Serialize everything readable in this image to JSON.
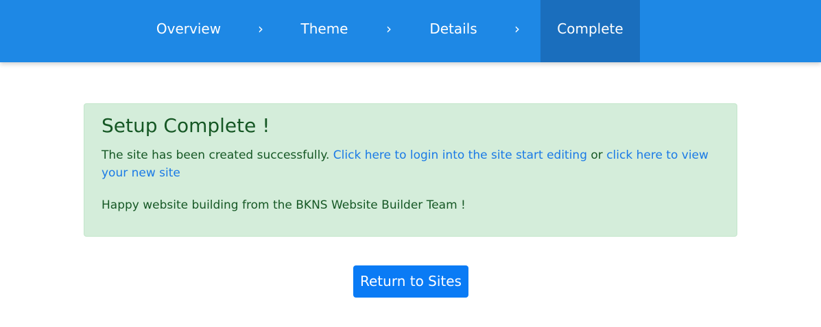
{
  "wizard": {
    "steps": [
      {
        "label": "Overview",
        "active": false
      },
      {
        "label": "Theme",
        "active": false
      },
      {
        "label": "Details",
        "active": false
      },
      {
        "label": "Complete",
        "active": true
      }
    ],
    "separator": "›"
  },
  "alert": {
    "title": "Setup Complete !",
    "text_prefix": "The site has been created successfully.",
    "login_link": "Click here to login into the site start editing",
    "connector": "or",
    "view_link": "click here to view your new site",
    "footer": "Happy website building from the BKNS Website Builder Team !"
  },
  "actions": {
    "return_label": "Return to Sites"
  },
  "colors": {
    "topbar": "#1e88e5",
    "active_step": "#1a6ebd",
    "alert_bg": "#d4edda",
    "alert_text": "#155724",
    "link": "#1a7ae6",
    "button": "#0a7bf5"
  }
}
